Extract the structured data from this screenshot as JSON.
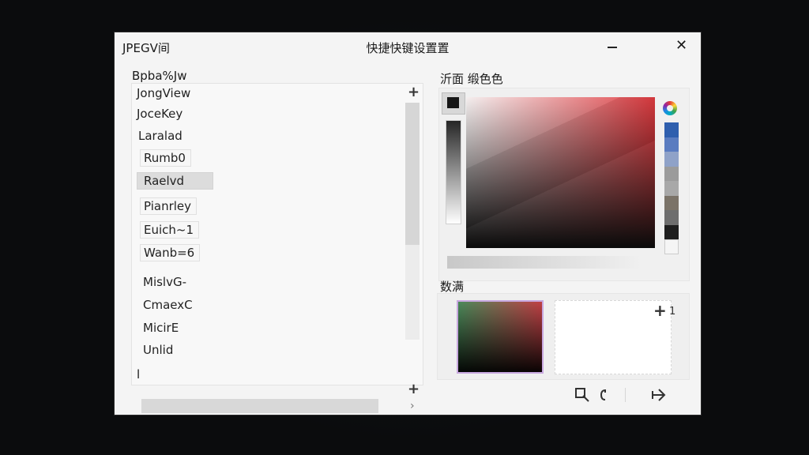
{
  "window": {
    "app_label": "JPEGV间",
    "title": "快捷快键设置置",
    "minimize_label": "minimize",
    "close_label": "✕"
  },
  "list": {
    "caption": "Bpba%Jw",
    "items": [
      {
        "label": "JongView"
      },
      {
        "label": "JoceKey"
      },
      {
        "label": "Laralad"
      },
      {
        "label": "Rumb0"
      },
      {
        "label": "Raelvd"
      },
      {
        "label": "Pianrley"
      },
      {
        "label": "Euich~1"
      },
      {
        "label": "Wanb=6"
      },
      {
        "label": "MislvG-"
      },
      {
        "label": "CmaexC"
      },
      {
        "label": "MicirE"
      },
      {
        "label": "Unlid"
      }
    ],
    "selected_index": 4,
    "add_top_icon": "plus-icon",
    "add_bottom_icon": "plus-icon",
    "cut_text": "l",
    "scroll_arrow": "›"
  },
  "color": {
    "caption": "沂面 缎色色",
    "current_color": "#161616",
    "palette": [
      "#2f5fae",
      "#5a7cc0",
      "#8fa2c8",
      "#9b9b9b",
      "#a8a8a8",
      "#7b7368",
      "#6e6e6e",
      "#1e1e1e",
      "#f5f5f5"
    ],
    "accent_red": "#e03b40"
  },
  "preview": {
    "caption": "数满",
    "add_label": "1"
  },
  "bottom_icons": [
    {
      "name": "crop-icon"
    },
    {
      "name": "copy-icon"
    },
    {
      "name": "arrow-right-icon"
    }
  ]
}
